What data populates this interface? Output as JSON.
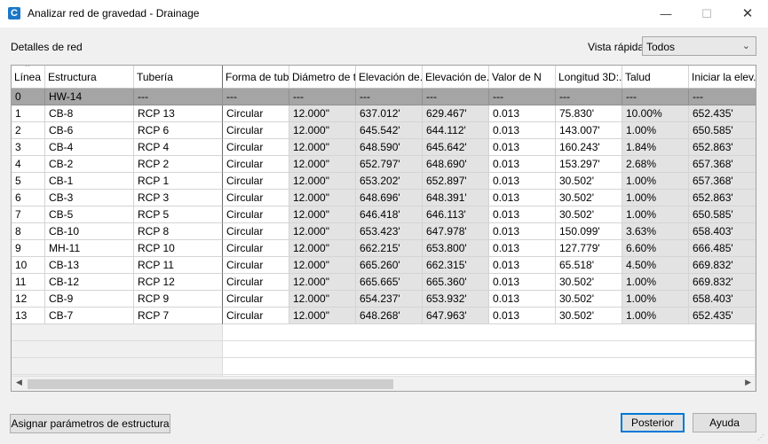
{
  "window": {
    "title": "Analizar red de gravedad - Drainage",
    "icon_letter": "C",
    "minimize": "—",
    "maximize": "☐",
    "close": "✕"
  },
  "section_label": "Detalles de red",
  "quick_view": {
    "label": "Vista rápida",
    "value": "Todos"
  },
  "table": {
    "columns": [
      "Línea",
      "Estructura",
      "Tubería",
      "Forma de tub...",
      "Diámetro de t...",
      "Elevación de...",
      "Elevación de...",
      "Valor de N",
      "Longitud 3D:...",
      "Talud",
      "Iniciar la elev..."
    ],
    "rows": [
      [
        "0",
        "HW-14",
        "---",
        "---",
        "---",
        "---",
        "---",
        "---",
        "---",
        "---",
        "---"
      ],
      [
        "1",
        "CB-8",
        "RCP 13",
        "Circular",
        "12.000\"",
        "637.012'",
        "629.467'",
        "0.013",
        "75.830'",
        "10.00%",
        "652.435'"
      ],
      [
        "2",
        "CB-6",
        "RCP 6",
        "Circular",
        "12.000\"",
        "645.542'",
        "644.112'",
        "0.013",
        "143.007'",
        "1.00%",
        "650.585'"
      ],
      [
        "3",
        "CB-4",
        "RCP 4",
        "Circular",
        "12.000\"",
        "648.590'",
        "645.642'",
        "0.013",
        "160.243'",
        "1.84%",
        "652.863'"
      ],
      [
        "4",
        "CB-2",
        "RCP 2",
        "Circular",
        "12.000\"",
        "652.797'",
        "648.690'",
        "0.013",
        "153.297'",
        "2.68%",
        "657.368'"
      ],
      [
        "5",
        "CB-1",
        "RCP 1",
        "Circular",
        "12.000\"",
        "653.202'",
        "652.897'",
        "0.013",
        "30.502'",
        "1.00%",
        "657.368'"
      ],
      [
        "6",
        "CB-3",
        "RCP 3",
        "Circular",
        "12.000\"",
        "648.696'",
        "648.391'",
        "0.013",
        "30.502'",
        "1.00%",
        "652.863'"
      ],
      [
        "7",
        "CB-5",
        "RCP 5",
        "Circular",
        "12.000\"",
        "646.418'",
        "646.113'",
        "0.013",
        "30.502'",
        "1.00%",
        "650.585'"
      ],
      [
        "8",
        "CB-10",
        "RCP 8",
        "Circular",
        "12.000\"",
        "653.423'",
        "647.978'",
        "0.013",
        "150.099'",
        "3.63%",
        "658.403'"
      ],
      [
        "9",
        "MH-11",
        "RCP 10",
        "Circular",
        "12.000\"",
        "662.215'",
        "653.800'",
        "0.013",
        "127.779'",
        "6.60%",
        "666.485'"
      ],
      [
        "10",
        "CB-13",
        "RCP 11",
        "Circular",
        "12.000\"",
        "665.260'",
        "662.315'",
        "0.013",
        "65.518'",
        "4.50%",
        "669.832'"
      ],
      [
        "11",
        "CB-12",
        "RCP 12",
        "Circular",
        "12.000\"",
        "665.665'",
        "665.360'",
        "0.013",
        "30.502'",
        "1.00%",
        "669.832'"
      ],
      [
        "12",
        "CB-9",
        "RCP 9",
        "Circular",
        "12.000\"",
        "654.237'",
        "653.932'",
        "0.013",
        "30.502'",
        "1.00%",
        "658.403'"
      ],
      [
        "13",
        "CB-7",
        "RCP 7",
        "Circular",
        "12.000\"",
        "648.268'",
        "647.963'",
        "0.013",
        "30.502'",
        "1.00%",
        "652.435'"
      ]
    ],
    "selected_row": 0
  },
  "buttons": {
    "assign": "Asignar parámetros de estructura",
    "posterior": "Posterior",
    "ayuda": "Ayuda"
  },
  "colors": {
    "accent": "#0078d7",
    "selected_row": "#a5a5a5",
    "readonly_cell": "#e3e3e3"
  }
}
